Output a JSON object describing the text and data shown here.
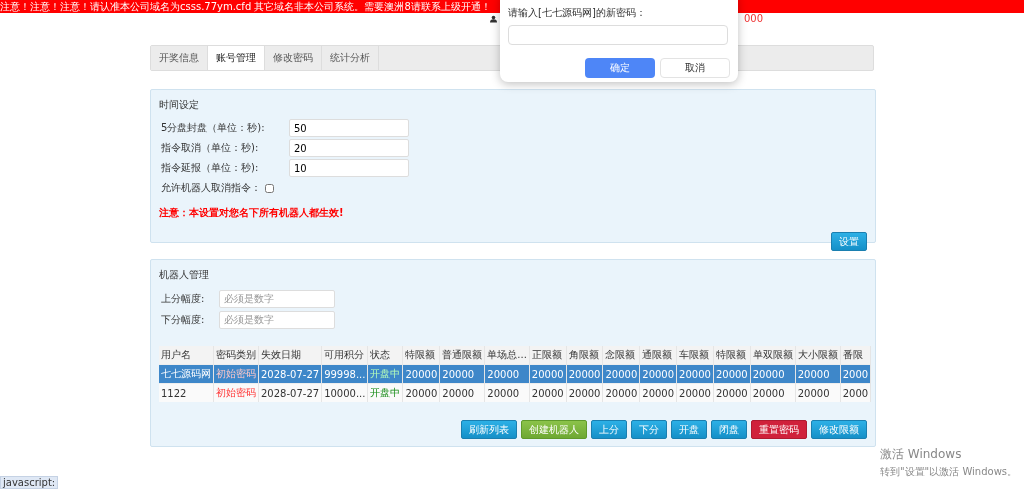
{
  "notice_bar": {
    "text": "注意！注意！注意！请认准本公司域名为csss.77ym.cfd 其它域名非本公司系统。需要澳洲8请联系上级开通！"
  },
  "header": {
    "balance_fragment": "000"
  },
  "tabs": [
    {
      "label": "开奖信息",
      "selected": false
    },
    {
      "label": "账号管理",
      "selected": true
    },
    {
      "label": "修改密码",
      "selected": false
    },
    {
      "label": "统计分析",
      "selected": false
    }
  ],
  "time_settings": {
    "title": "时间设定",
    "fields": [
      {
        "label": "5分盘封盘（单位：秒):",
        "value": "50"
      },
      {
        "label": "指令取消（单位：秒):",
        "value": "20"
      },
      {
        "label": "指令延报（单位：秒):",
        "value": "10"
      }
    ],
    "allow_cancel": {
      "label": "允许机器人取消指令：",
      "checked": false
    },
    "note": "注意：本设置对您名下所有机器人都生效!",
    "button": "设置"
  },
  "robot_management": {
    "title": "机器人管理",
    "fields": [
      {
        "label": "上分幅度:",
        "placeholder": "必须是数字"
      },
      {
        "label": "下分幅度:",
        "placeholder": "必须是数字"
      }
    ],
    "table": {
      "columns": [
        "用户名",
        "密码类别",
        "失效日期",
        "可用积分",
        "状态",
        "特限额",
        "普通限额",
        "单场总...",
        "正限额",
        "角限额",
        "念限额",
        "通限额",
        "车限额",
        "特限额",
        "单双限额",
        "大小限额",
        "番限"
      ],
      "rows": [
        {
          "selected": true,
          "cells": [
            "七七源码网",
            "初始密码",
            "2028-07-27",
            "99998...",
            "开盘中",
            "20000",
            "20000",
            "20000",
            "20000",
            "20000",
            "20000",
            "20000",
            "20000",
            "20000",
            "20000",
            "20000",
            "2000"
          ]
        },
        {
          "selected": false,
          "cells": [
            "1122",
            "初始密码",
            "2028-07-27",
            "10000...",
            "开盘中",
            "20000",
            "20000",
            "20000",
            "20000",
            "20000",
            "20000",
            "20000",
            "20000",
            "20000",
            "20000",
            "20000",
            "2000"
          ]
        }
      ]
    },
    "buttons": [
      {
        "label": "刷新列表",
        "kind": "info"
      },
      {
        "label": "创建机器人",
        "kind": "success"
      },
      {
        "label": "上分",
        "kind": "info"
      },
      {
        "label": "下分",
        "kind": "info"
      },
      {
        "label": "开盘",
        "kind": "info"
      },
      {
        "label": "闭盘",
        "kind": "info"
      },
      {
        "label": "重置密码",
        "kind": "danger"
      },
      {
        "label": "修改限额",
        "kind": "info"
      }
    ]
  },
  "dialog": {
    "prompt": "请输入[七七源码网]的新密码：",
    "confirm": "确定",
    "cancel": "取消"
  },
  "status_link": "javascript:",
  "os_watermark": {
    "title": "激活 Windows",
    "subtitle": "转到\"设置\"以激活 Windows。"
  }
}
